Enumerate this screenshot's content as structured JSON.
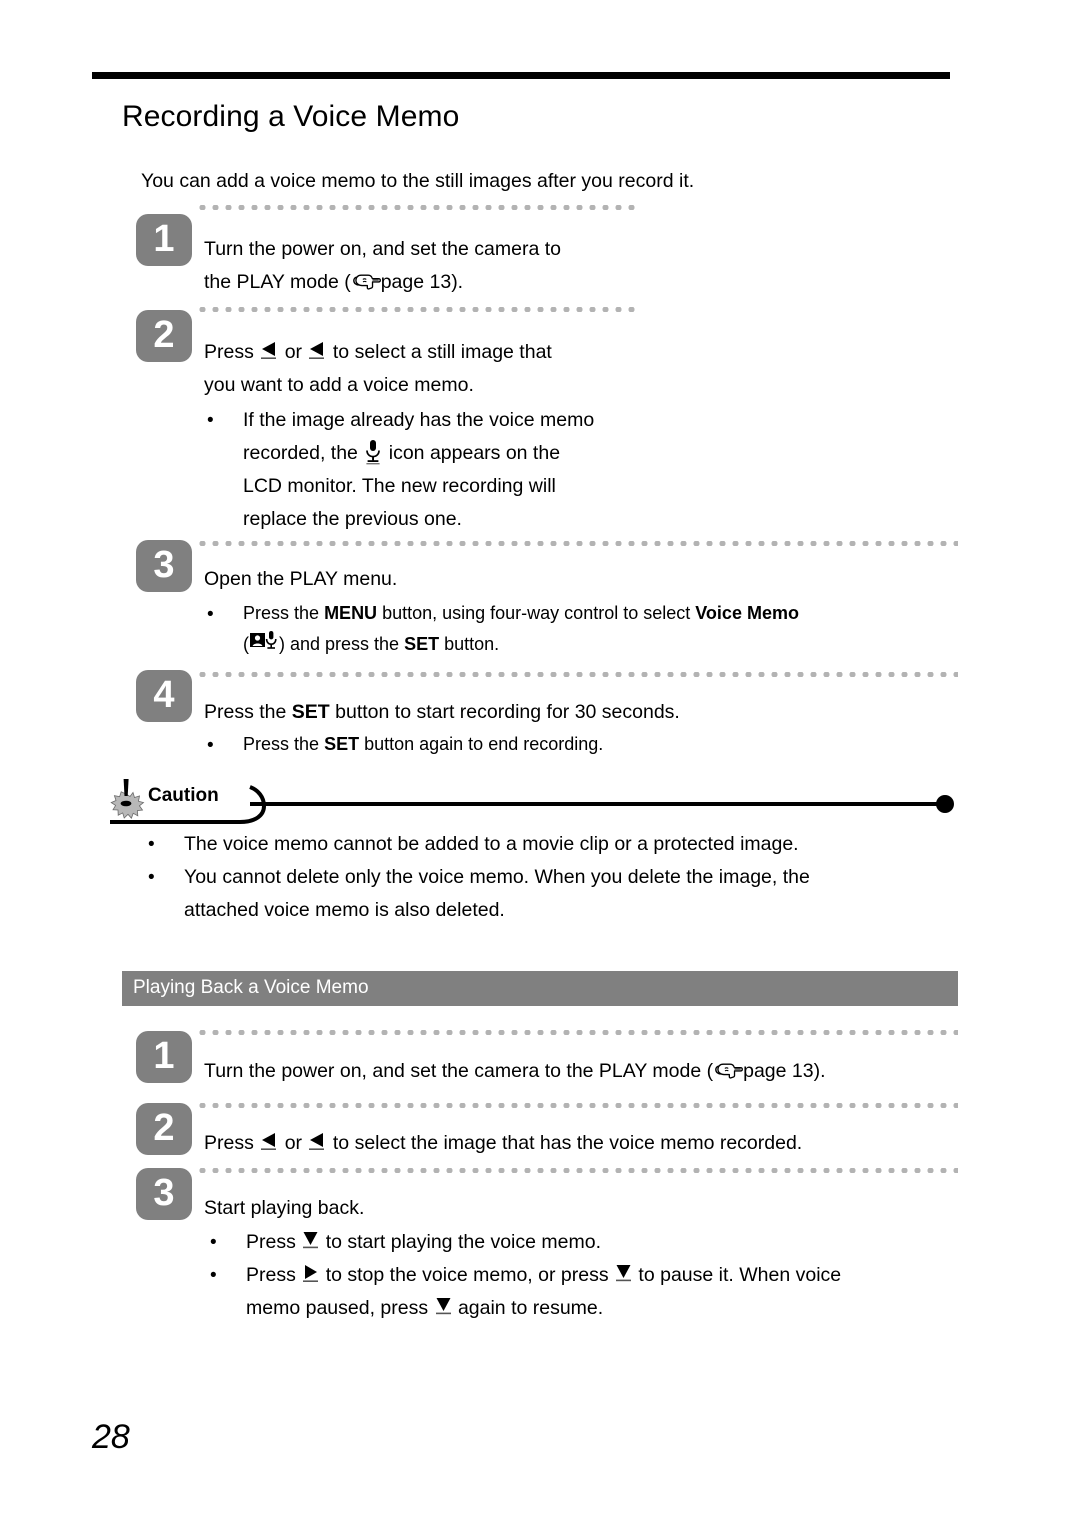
{
  "document": {
    "page_number": "28",
    "title": "Recording a Voice Memo",
    "intro": "You can add a voice memo to the still images after you record it."
  },
  "colors": {
    "step_chip_background": "#808080",
    "step_chip_text": "#ffffff",
    "section_bar_background": "#808080",
    "section_bar_text": "#ffffff",
    "dotted_rule": "#b3b3b3",
    "rule": "#000000"
  },
  "recording": {
    "steps": [
      {
        "number": "1",
        "line1": "Turn the power on, and set the camera to",
        "line2_pre": "the PLAY mode (",
        "line2_icon": "pointing-hand-icon",
        "line2_post": "page 13)."
      },
      {
        "number": "2",
        "line1_pre": "Press",
        "line1_icon_a": "left-triangle-icon",
        "line1_mid": "or",
        "line1_icon_b": "left-triangle-icon",
        "line1_post": "to select a still image that",
        "line2": "you want to add a voice memo.",
        "bullets": [
          {
            "seg1": "If the image already has the voice memo",
            "seg2_pre": "recorded, the",
            "seg2_icon": "microphone-icon",
            "seg2_post": "icon appears on the",
            "seg3": "LCD monitor. The new recording will",
            "seg4": "replace the previous one."
          }
        ]
      },
      {
        "number": "3",
        "line1": "Open the PLAY menu.",
        "bullets": [
          {
            "seg1_pre": "Press the",
            "seg1_strong_a": "MENU",
            "seg1_mid": "button, using four-way control to select",
            "seg1_strong_b": "Voice Memo",
            "seg2_pre": "(",
            "seg2_icon": "voice-memo-menu-icon",
            "seg2_mid": ") and press the",
            "seg2_strong": "SET",
            "seg2_post": "button."
          }
        ]
      },
      {
        "number": "4",
        "line1_pre": "Press the",
        "line1_strong": "SET",
        "line1_post": "button to start recording for 30 seconds.",
        "bullets": [
          {
            "seg1_pre": "Press the",
            "seg1_strong": "SET",
            "seg1_post": "button again to end recording."
          }
        ]
      }
    ]
  },
  "caution": {
    "label": "Caution",
    "icon": "caution-burst-icon",
    "items": [
      {
        "line1": "The voice memo cannot be added to a movie clip or a protected image."
      },
      {
        "line1": "You cannot delete only the voice memo. When you delete the image, the",
        "line2": "attached voice memo is also deleted."
      }
    ]
  },
  "playback": {
    "section_title": "Playing Back a Voice Memo",
    "steps": [
      {
        "number": "1",
        "line1_pre": "Turn the power on, and set the camera to the PLAY mode (",
        "line1_icon": "pointing-hand-icon",
        "line1_post": "page 13)."
      },
      {
        "number": "2",
        "line1_pre": "Press",
        "line1_icon_a": "left-triangle-icon",
        "line1_mid": "or",
        "line1_icon_b": "left-triangle-icon",
        "line1_post": "to select the image that has the voice memo recorded."
      },
      {
        "number": "3",
        "line1": "Start playing back.",
        "bullets": [
          {
            "seg1_pre": "Press",
            "seg1_icon": "down-triangle-icon",
            "seg1_post": "to start playing the voice memo."
          },
          {
            "seg1_pre": "Press",
            "seg1_icon_a": "right-triangle-icon",
            "seg1_mid": "to stop the voice memo, or press",
            "seg1_icon_b": "down-triangle-icon",
            "seg1_post": "to pause it. When voice",
            "seg2_pre": "memo paused, press",
            "seg2_icon": "down-triangle-icon",
            "seg2_post": "again to resume."
          }
        ]
      }
    ]
  }
}
